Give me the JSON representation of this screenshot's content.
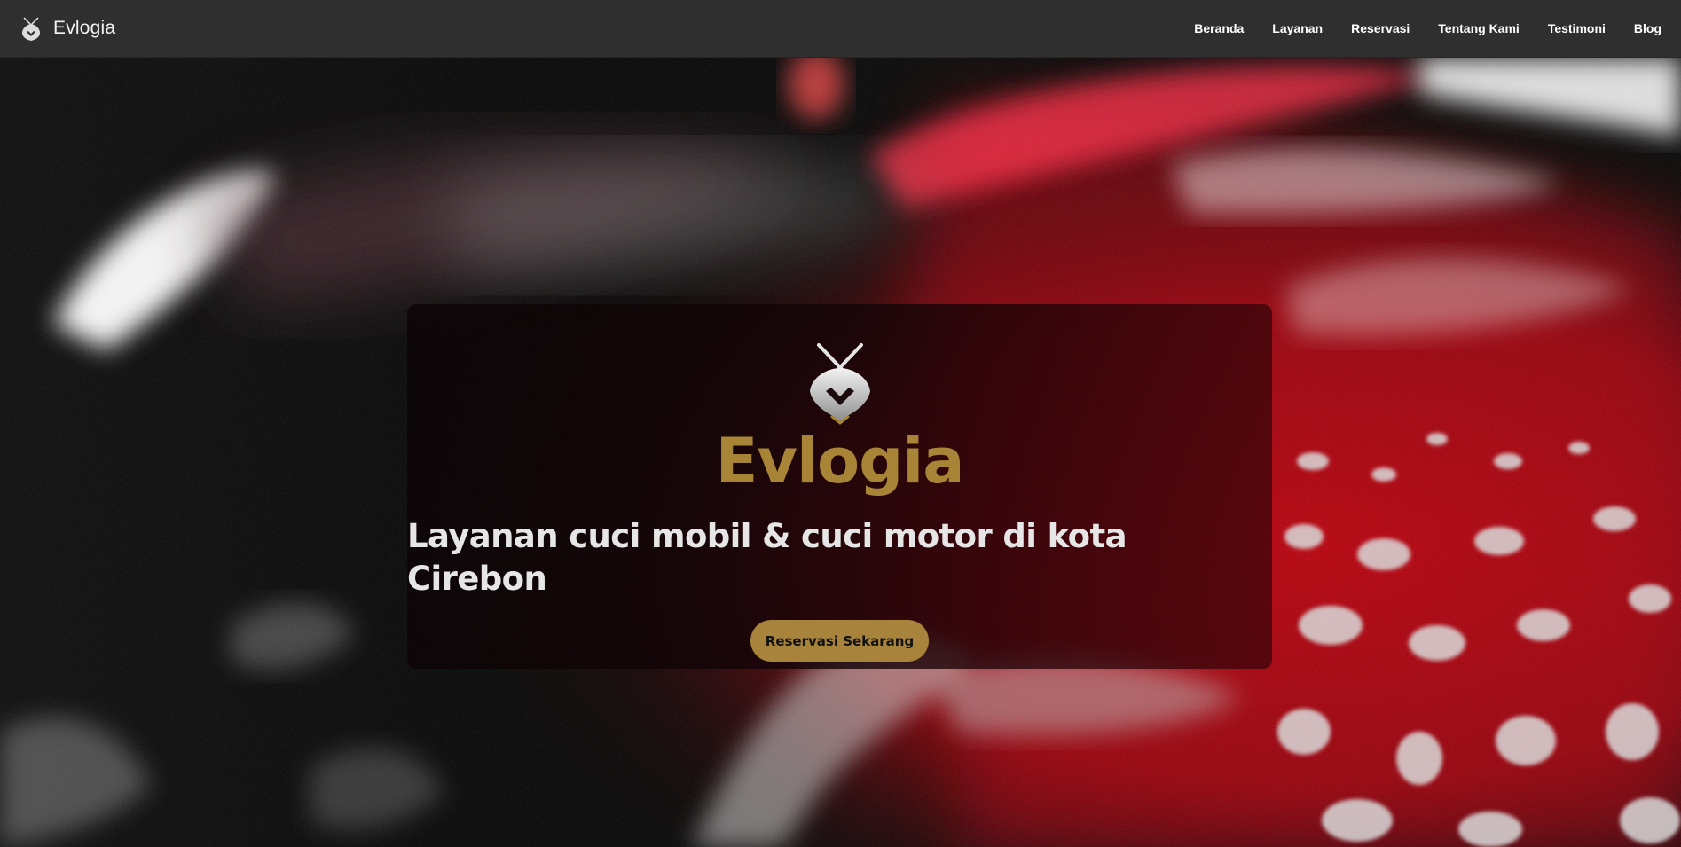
{
  "navbar": {
    "brand_name": "Evlogia",
    "brand_icon": "evlogia-logo-icon",
    "links": [
      "Beranda",
      "Layanan",
      "Reservasi",
      "Tentang Kami",
      "Testimoni",
      "Blog"
    ]
  },
  "hero": {
    "background_image": "red-car-with-soap-foam-photo",
    "emblem_icon": "crossed-spray-guns-emblem-icon",
    "title": "Evlogia",
    "subtitle": "Layanan cuci mobil & cuci motor di kota Cirebon",
    "cta_label": "Reservasi Sekarang"
  },
  "colors": {
    "navbar_bg": "#2f2f2f",
    "brand_gold": "#a88536",
    "button_gold": "#a8833b",
    "text_light": "#e6e6e6"
  }
}
